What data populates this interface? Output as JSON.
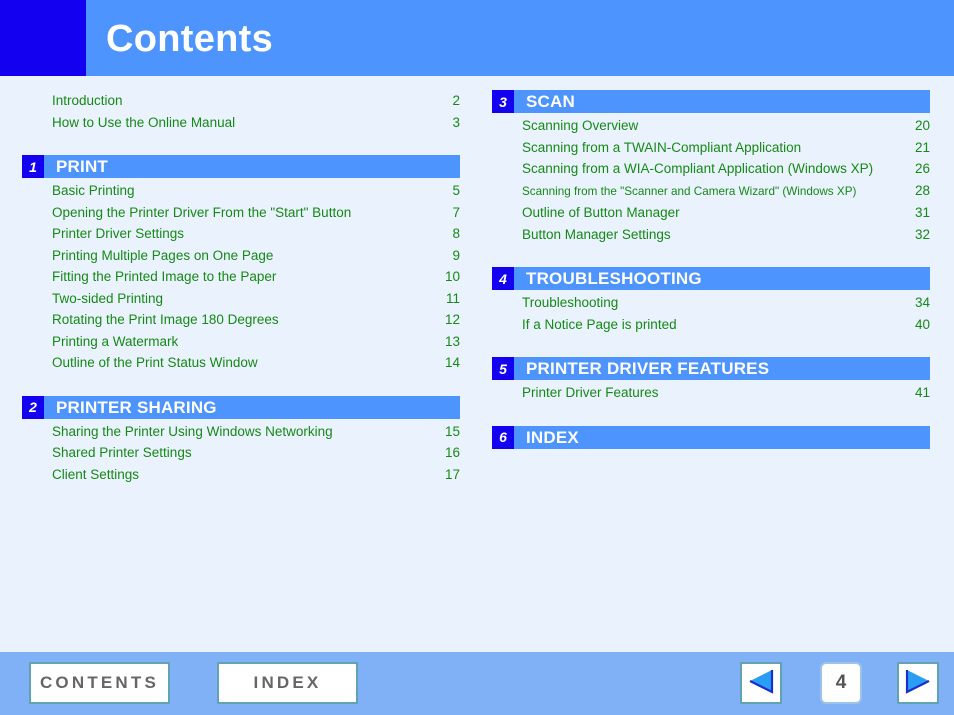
{
  "header": {
    "title": "Contents",
    "accent_block_color": "#1400f0",
    "bar_color": "#4d94ff"
  },
  "colors": {
    "background": "#eaf2fd",
    "link_green": "#168a16",
    "section_bar": "#4d94ff",
    "section_num_badge": "#1400f0",
    "footer_bar": "#80b1f7",
    "button_border": "#61a3b0",
    "arrow_fill": "#2a9df4"
  },
  "left_column": {
    "intro": [
      {
        "title": "Introduction",
        "page": "2"
      },
      {
        "title": "How to Use the Online Manual",
        "page": "3"
      }
    ],
    "sections": [
      {
        "number": "1",
        "label": "PRINT",
        "entries": [
          {
            "title": "Basic Printing",
            "page": "5"
          },
          {
            "title": "Opening the Printer Driver From the \"Start\" Button",
            "page": "7"
          },
          {
            "title": "Printer Driver Settings",
            "page": "8"
          },
          {
            "title": "Printing Multiple Pages on One Page",
            "page": "9"
          },
          {
            "title": "Fitting the Printed Image to the Paper",
            "page": "10"
          },
          {
            "title": "Two-sided Printing",
            "page": "11"
          },
          {
            "title": "Rotating the Print Image 180 Degrees",
            "page": "12"
          },
          {
            "title": "Printing a Watermark",
            "page": "13"
          },
          {
            "title": "Outline of the Print Status Window",
            "page": "14"
          }
        ]
      },
      {
        "number": "2",
        "label": "PRINTER SHARING",
        "entries": [
          {
            "title": "Sharing the Printer Using Windows Networking",
            "page": "15"
          },
          {
            "title": "Shared Printer Settings",
            "page": "16"
          },
          {
            "title": "Client Settings",
            "page": "17"
          }
        ]
      }
    ]
  },
  "right_column": {
    "sections": [
      {
        "number": "3",
        "label": "SCAN",
        "entries": [
          {
            "title": "Scanning Overview",
            "page": "20"
          },
          {
            "title": "Scanning from a TWAIN-Compliant Application",
            "page": "21"
          },
          {
            "title": "Scanning from a WIA-Compliant Application (Windows XP)",
            "page": "26"
          },
          {
            "title": "Scanning from the \"Scanner and Camera Wizard\" (Windows XP)",
            "page": "28"
          },
          {
            "title": "Outline of Button Manager",
            "page": "31"
          },
          {
            "title": "Button Manager Settings",
            "page": "32"
          }
        ]
      },
      {
        "number": "4",
        "label": "TROUBLESHOOTING",
        "entries": [
          {
            "title": "Troubleshooting",
            "page": "34"
          },
          {
            "title": "If a Notice Page is printed",
            "page": "40"
          }
        ]
      },
      {
        "number": "5",
        "label": "PRINTER DRIVER FEATURES",
        "entries": [
          {
            "title": "Printer Driver Features",
            "page": "41"
          }
        ]
      },
      {
        "number": "6",
        "label": "INDEX",
        "entries": []
      }
    ]
  },
  "footer": {
    "contents_button": "CONTENTS",
    "index_button": "INDEX",
    "prev_icon": "triangle-left-icon",
    "next_icon": "triangle-right-icon",
    "page_number": "4"
  }
}
